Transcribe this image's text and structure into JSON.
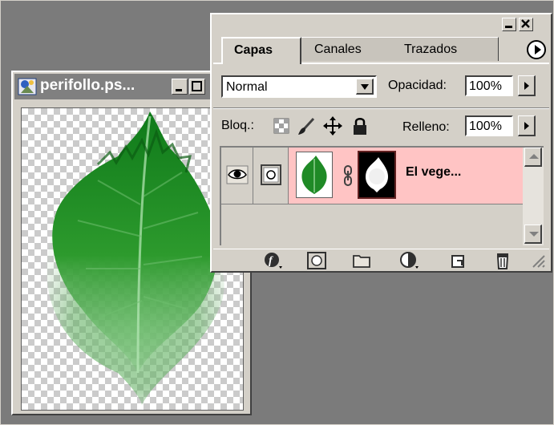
{
  "document": {
    "title": "perifollo.ps..."
  },
  "layers_palette": {
    "tabs": [
      {
        "label": "Capas",
        "active": true
      },
      {
        "label": "Canales",
        "active": false
      },
      {
        "label": "Trazados",
        "active": false
      }
    ],
    "blend_mode": "Normal",
    "opacity_label": "Opacidad:",
    "opacity_value": "100%",
    "lock_label": "Bloq.:",
    "fill_label": "Relleno:",
    "fill_value": "100%",
    "layers": [
      {
        "name": "El vege...",
        "visible": true,
        "selected": true
      }
    ],
    "bottom_icons": [
      "layer-style-icon",
      "layer-mask-icon",
      "new-set-icon",
      "adjustment-layer-icon",
      "new-layer-icon",
      "trash-icon"
    ]
  },
  "colors": {
    "workspace": "#7b7b7b",
    "panel": "#d4d0c8",
    "selected_layer": "#ffc4c4",
    "doc_title_bar": "#808080"
  }
}
